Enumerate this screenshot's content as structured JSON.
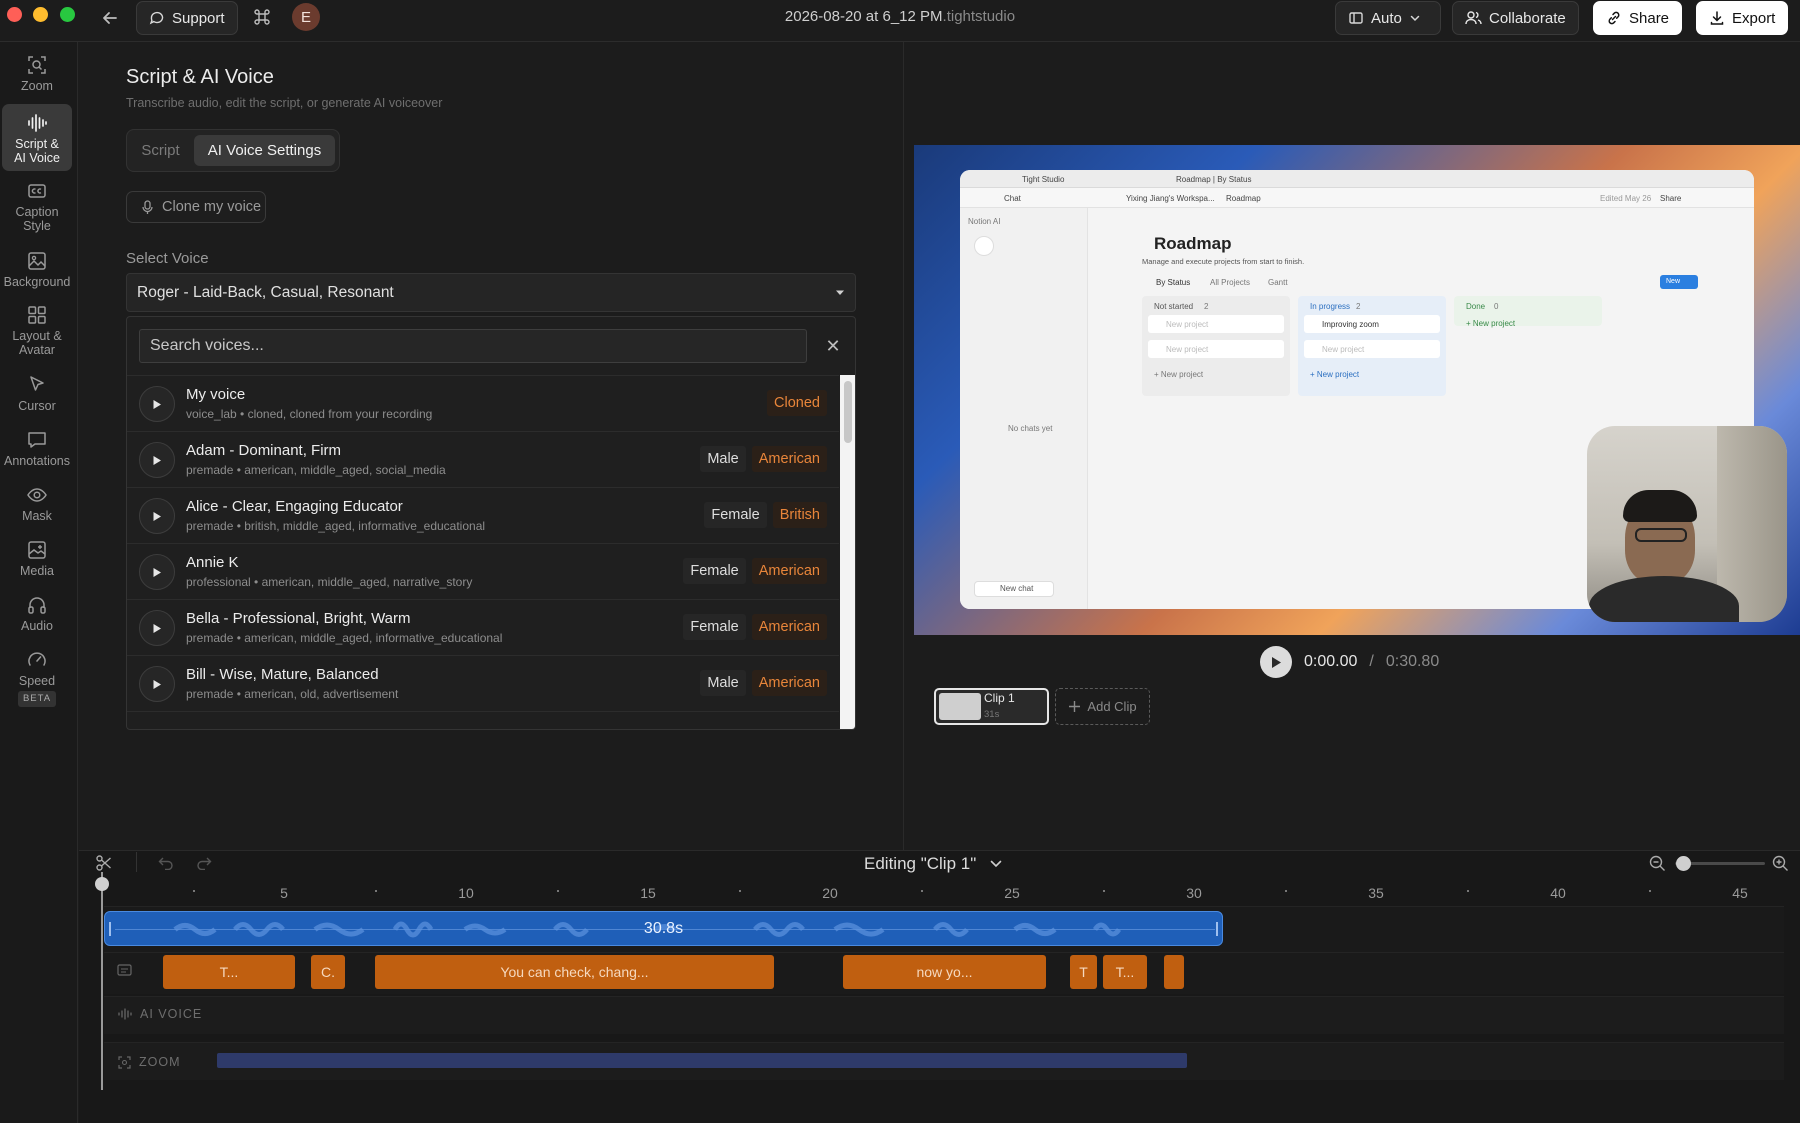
{
  "titlebar": {
    "support_label": "Support",
    "avatar_initial": "E",
    "doc_title": "2026-08-20 at 6_12 PM",
    "doc_ext": ".tightstudio",
    "auto_label": "Auto",
    "collaborate_label": "Collaborate",
    "share_label": "Share",
    "export_label": "Export"
  },
  "rail": {
    "zoom": "Zoom",
    "script_l1": "Script &",
    "script_l2": "AI Voice",
    "caption_l1": "Caption",
    "caption_l2": "Style",
    "background": "Background",
    "layout_l1": "Layout &",
    "layout_l2": "Avatar",
    "cursor": "Cursor",
    "annotations": "Annotations",
    "mask": "Mask",
    "media": "Media",
    "audio": "Audio",
    "speed": "Speed",
    "beta": "BETA"
  },
  "panel": {
    "title": "Script & AI Voice",
    "subtitle": "Transcribe audio, edit the script, or generate AI voiceover",
    "tab_script": "Script",
    "tab_ai_voice": "AI Voice Settings",
    "clone_label": "Clone my voice",
    "select_label": "Select Voice",
    "selected_voice": "Roger - Laid-Back, Casual, Resonant",
    "search_placeholder": "Search voices...",
    "voices": [
      {
        "name": "My voice",
        "meta": "voice_lab • cloned, cloned from your recording",
        "tag1": "",
        "tag2": "Cloned"
      },
      {
        "name": "Adam - Dominant, Firm",
        "meta": "premade • american, middle_aged, social_media",
        "tag1": "Male",
        "tag2": "American"
      },
      {
        "name": "Alice - Clear, Engaging Educator",
        "meta": "premade • british, middle_aged, informative_educational",
        "tag1": "Female",
        "tag2": "British"
      },
      {
        "name": "Annie K",
        "meta": "professional • american, middle_aged, narrative_story",
        "tag1": "Female",
        "tag2": "American"
      },
      {
        "name": "Bella - Professional, Bright, Warm",
        "meta": "premade • american, middle_aged, informative_educational",
        "tag1": "Female",
        "tag2": "American"
      },
      {
        "name": "Bill - Wise, Mature, Balanced",
        "meta": "premade • american, old, advertisement",
        "tag1": "Male",
        "tag2": "American"
      }
    ]
  },
  "preview": {
    "app_name": "Tight Studio",
    "tab_title": "Roadmap | By Status",
    "chat_label": "Chat",
    "workspace": "Yixing Jiang's Workspa...",
    "crumb": "Roadmap",
    "edited": "Edited May 26",
    "share": "Share",
    "notion_ai": "Notion AI",
    "no_chats": "No chats yet",
    "new_chat": "New chat",
    "page_title": "Roadmap",
    "page_desc": "Manage and execute projects from start to finish.",
    "view_by_status": "By Status",
    "view_all": "All Projects",
    "view_gantt": "Gantt",
    "new_btn": "New",
    "col_not_started": "Not started",
    "col_not_started_n": "2",
    "col_in_progress": "In progress",
    "col_in_progress_n": "2",
    "col_done": "Done",
    "col_done_n": "0",
    "card_new_project": "New project",
    "card_improving": "Improving zoom",
    "add_new_project": "+ New project"
  },
  "transport": {
    "current": "0:00.00",
    "sep": "/",
    "total": "0:30.80"
  },
  "clips": {
    "clip1_name": "Clip 1",
    "clip1_len": "31s",
    "add_clip": "Add Clip"
  },
  "timeline": {
    "editing": "Editing \"Clip 1\"",
    "ruler": [
      "5",
      "10",
      "15",
      "20",
      "25",
      "30",
      "35",
      "40",
      "45"
    ],
    "audio_duration": "30.8s",
    "captions": [
      "T...",
      "C.",
      "You can check, chang...",
      "now yo...",
      "T",
      "T...",
      ""
    ],
    "ai_voice_label": "AI VOICE",
    "zoom_label": "ZOOM"
  },
  "colors": {
    "accent_orange": "#c05f10",
    "audio_blue": "#1f5fb8",
    "tag_orange": "#e8853a"
  }
}
